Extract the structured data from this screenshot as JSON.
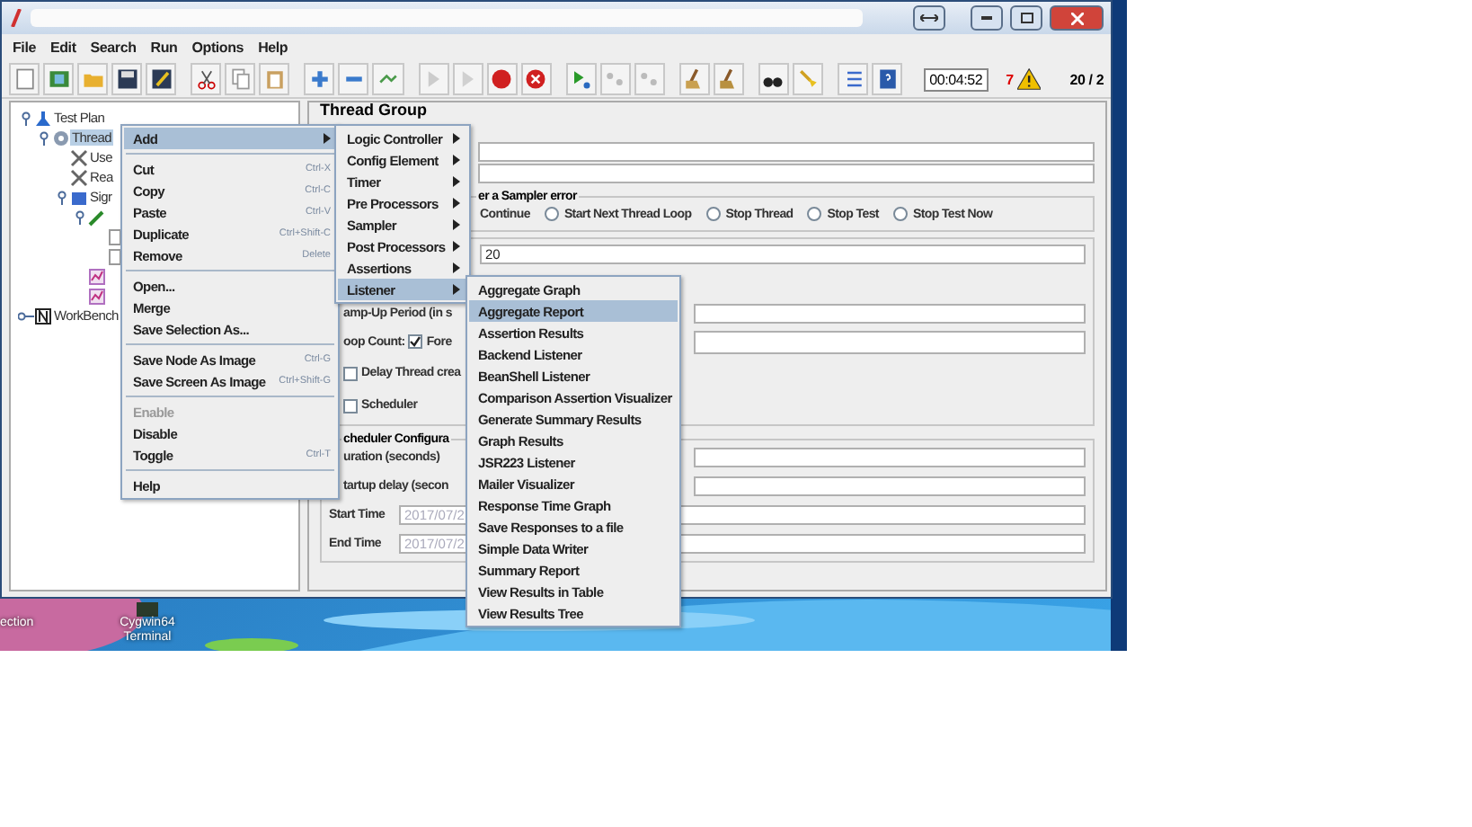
{
  "menu_bar": [
    {
      "label": "File"
    },
    {
      "label": "Edit"
    },
    {
      "label": "Search"
    },
    {
      "label": "Run"
    },
    {
      "label": "Options"
    },
    {
      "label": "Help"
    }
  ],
  "toolbar": {
    "timer": "00:04:52",
    "error_count": "7",
    "thread_count": "20 / 2"
  },
  "tree": [
    {
      "label": "Test Plan",
      "kind": "plan",
      "expanded": true,
      "selected": false,
      "children": [
        {
          "label": "Thread",
          "kind": "threads",
          "expanded": true,
          "selected": true,
          "children": [
            {
              "label": "Use",
              "kind": "config",
              "selected": false
            },
            {
              "label": "Rea",
              "kind": "config",
              "selected": false
            },
            {
              "label": "Sigr",
              "kind": "controller",
              "expanded": true,
              "selected": false,
              "children": [
                {
                  "kind": "sampler",
                  "expanded": true,
                  "children": [
                    {
                      "kind": "element"
                    },
                    {
                      "kind": "element"
                    }
                  ]
                },
                {
                  "kind": "listener"
                },
                {
                  "kind": "listener"
                }
              ]
            }
          ]
        }
      ]
    },
    {
      "label": "WorkBench",
      "kind": "workbench",
      "expanded": false,
      "selected": false
    }
  ],
  "panel": {
    "title": "Thread Group",
    "sampler_error": {
      "legend": "er a Sampler error",
      "options": [
        {
          "label": "Continue"
        },
        {
          "label": "Start Next Thread Loop",
          "selected": false
        },
        {
          "label": "Stop Thread",
          "selected": false
        },
        {
          "label": "Stop Test",
          "selected": false
        },
        {
          "label": "Stop Test Now",
          "selected": false
        }
      ]
    },
    "threads_value": "20",
    "ramp_label": "amp-Up Period (in s",
    "loop": {
      "label": "oop Count:",
      "forever_label": "Fore",
      "forever_checked": true
    },
    "delay": {
      "label": "Delay Thread crea",
      "checked": false
    },
    "scheduler": {
      "label": "Scheduler",
      "checked": false
    },
    "scheduler_config": {
      "legend": "cheduler Configura",
      "rows": [
        {
          "label": "uration (seconds)"
        },
        {
          "label": "tartup delay (secon"
        },
        {
          "label": "Start Time",
          "value": "2017/07/2"
        },
        {
          "label": "End Time",
          "value": "2017/07/2"
        }
      ]
    }
  },
  "context_menu": [
    [
      {
        "label": "Add",
        "has_submenu": true,
        "selected": true
      }
    ],
    [
      {
        "label": "Cut",
        "shortcut": "Ctrl-X",
        "selected": false,
        "disabled": false
      },
      {
        "label": "Copy",
        "shortcut": "Ctrl-C",
        "selected": false,
        "disabled": false
      },
      {
        "label": "Paste",
        "shortcut": "Ctrl-V",
        "selected": false,
        "disabled": false
      },
      {
        "label": "Duplicate",
        "shortcut": "Ctrl+Shift-C",
        "selected": false,
        "disabled": false
      },
      {
        "label": "Remove",
        "shortcut": "Delete",
        "selected": false,
        "disabled": false
      }
    ],
    [
      {
        "label": "Open...",
        "selected": false,
        "disabled": false
      },
      {
        "label": "Merge",
        "selected": false,
        "disabled": false
      },
      {
        "label": "Save Selection As...",
        "selected": false,
        "disabled": false
      }
    ],
    [
      {
        "label": "Save Node As Image",
        "shortcut": "Ctrl-G",
        "selected": false,
        "disabled": false
      },
      {
        "label": "Save Screen As Image",
        "shortcut": "Ctrl+Shift-G",
        "selected": false,
        "disabled": false
      }
    ],
    [
      {
        "label": "Enable",
        "selected": false,
        "disabled": true
      },
      {
        "label": "Disable",
        "selected": false,
        "disabled": false
      },
      {
        "label": "Toggle",
        "shortcut": "Ctrl-T",
        "selected": false,
        "disabled": false
      }
    ],
    [
      {
        "label": "Help",
        "selected": false,
        "disabled": false
      }
    ]
  ],
  "add_submenu": [
    {
      "label": "Logic Controller",
      "selected": false
    },
    {
      "label": "Config Element",
      "selected": false
    },
    {
      "label": "Timer",
      "selected": false
    },
    {
      "label": "Pre Processors",
      "selected": false
    },
    {
      "label": "Sampler",
      "selected": false
    },
    {
      "label": "Post Processors",
      "selected": false
    },
    {
      "label": "Assertions",
      "selected": false
    },
    {
      "label": "Listener",
      "selected": true
    }
  ],
  "listener_submenu": [
    {
      "label": "Aggregate Graph",
      "selected": false
    },
    {
      "label": "Aggregate Report",
      "selected": true
    },
    {
      "label": "Assertion Results",
      "selected": false
    },
    {
      "label": "Backend Listener",
      "selected": false
    },
    {
      "label": "BeanShell Listener",
      "selected": false
    },
    {
      "label": "Comparison Assertion Visualizer",
      "selected": false
    },
    {
      "label": "Generate Summary Results",
      "selected": false
    },
    {
      "label": "Graph Results",
      "selected": false
    },
    {
      "label": "JSR223 Listener",
      "selected": false
    },
    {
      "label": "Mailer Visualizer",
      "selected": false
    },
    {
      "label": "Response Time Graph",
      "selected": false
    },
    {
      "label": "Save Responses to a file",
      "selected": false
    },
    {
      "label": "Simple Data Writer",
      "selected": false
    },
    {
      "label": "Summary Report",
      "selected": false
    },
    {
      "label": "View Results in Table",
      "selected": false
    },
    {
      "label": "View Results Tree",
      "selected": false
    }
  ],
  "desktop_icons": [
    {
      "label": "ection"
    },
    {
      "label": "Cygwin64 Terminal"
    }
  ]
}
